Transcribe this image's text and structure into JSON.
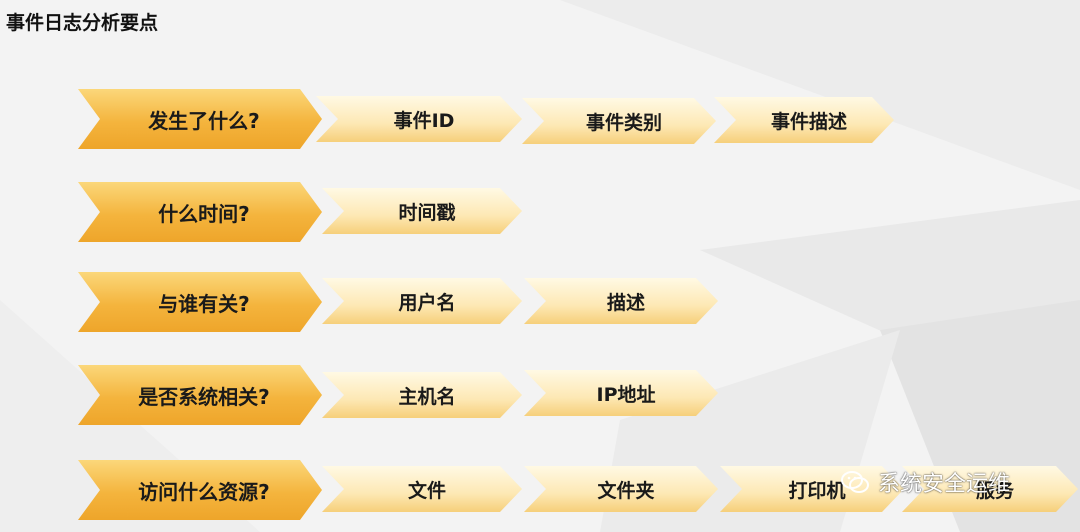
{
  "title": "事件日志分析要点",
  "rows": [
    {
      "question": "发生了什么?",
      "items": [
        "事件ID",
        "事件类别",
        "事件描述"
      ]
    },
    {
      "question": "什么时间?",
      "items": [
        "时间戳"
      ]
    },
    {
      "question": "与谁有关?",
      "items": [
        "用户名",
        "描述"
      ]
    },
    {
      "question": "是否系统相关?",
      "items": [
        "主机名",
        "IP地址"
      ]
    },
    {
      "question": "访问什么资源?",
      "items": [
        "文件",
        "文件夹",
        "打印机",
        "服务"
      ]
    }
  ],
  "watermark": {
    "text": "系统安全运维",
    "icon": "wechat-icon"
  },
  "colors": {
    "main_chevron": "#f4b43d",
    "sub_chevron": "#fde8b4",
    "background": "#f2f2f2"
  }
}
